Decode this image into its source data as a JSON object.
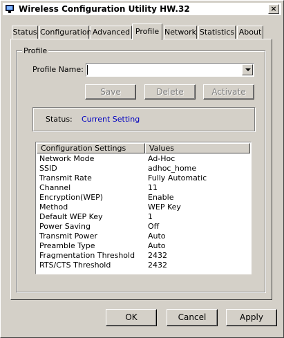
{
  "window": {
    "title": "Wireless Configuration Utility HW.32",
    "close_label": "×"
  },
  "tabs": [
    {
      "label": "Status"
    },
    {
      "label": "Configuration"
    },
    {
      "label": "Advanced"
    },
    {
      "label": "Profile",
      "active": true
    },
    {
      "label": "Network"
    },
    {
      "label": "Statistics"
    },
    {
      "label": "About"
    }
  ],
  "profile": {
    "group_label": "Profile",
    "name_label": "Profile Name:",
    "name_value": "",
    "buttons": {
      "save": "Save",
      "delete": "Delete",
      "activate": "Activate"
    },
    "status_label": "Status:",
    "status_value": "Current Setting"
  },
  "settings_table": {
    "headers": [
      "Configuration Settings",
      "Values"
    ],
    "rows": [
      [
        "Network Mode",
        "Ad-Hoc"
      ],
      [
        "SSID",
        "adhoc_home"
      ],
      [
        "Transmit Rate",
        "Fully Automatic"
      ],
      [
        "Channel",
        "11"
      ],
      [
        "Encryption(WEP)",
        "Enable"
      ],
      [
        "Method",
        "WEP Key"
      ],
      [
        "Default WEP Key",
        "1"
      ],
      [
        "Power Saving",
        "Off"
      ],
      [
        "Transmit Power",
        "Auto"
      ],
      [
        "Preamble Type",
        "Auto"
      ],
      [
        "Fragmentation Threshold",
        "2432"
      ],
      [
        "RTS/CTS Threshold",
        "2432"
      ]
    ]
  },
  "dialog_buttons": {
    "ok": "OK",
    "cancel": "Cancel",
    "apply": "Apply"
  },
  "colors": {
    "face": "#d4d0c8",
    "status_value": "#0000c0"
  }
}
